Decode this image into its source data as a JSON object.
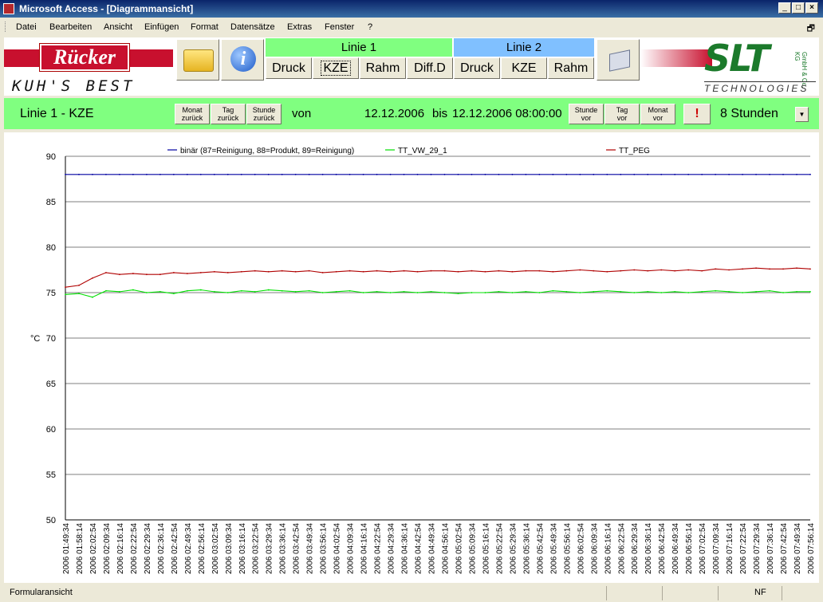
{
  "window": {
    "title": "Microsoft Access - [Diagrammansicht]"
  },
  "menu": [
    "Datei",
    "Bearbeiten",
    "Ansicht",
    "Einfügen",
    "Format",
    "Datensätze",
    "Extras",
    "Fenster",
    "?"
  ],
  "branding": {
    "left_logo": "Rücker",
    "left_tagline": "KUH'S BEST",
    "right_logo": "SLT",
    "right_logo_small": "GmbH & Co. KG",
    "right_tagline": "TECHNOLOGIES"
  },
  "colors": {
    "linie1": "#80ff80",
    "linie2": "#80c0ff",
    "series_binar": "#0000a0",
    "series_tt_vw": "#00e000",
    "series_tt_peg": "#b00000"
  },
  "toolbar": {
    "open_icon": "folder-icon",
    "info_icon": "info-icon",
    "print_icon": "printer-icon",
    "linie1": {
      "label": "Linie 1",
      "buttons": [
        "Druck",
        "KZE",
        "Rahm",
        "Diff.D"
      ],
      "active": "KZE"
    },
    "linie2": {
      "label": "Linie 2",
      "buttons": [
        "Druck",
        "KZE",
        "Rahm"
      ]
    }
  },
  "nav": {
    "view_title": "Linie 1 - KZE",
    "back_buttons": [
      {
        "l1": "Monat",
        "l2": "zurück"
      },
      {
        "l1": "Tag",
        "l2": "zurück"
      },
      {
        "l1": "Stunde",
        "l2": "zurück"
      }
    ],
    "von_label": "von",
    "from_date": "12.12.2006",
    "bis_label": "bis",
    "to_date": "12.12.2006 08:00:00",
    "fwd_buttons": [
      {
        "l1": "Stunde",
        "l2": "vor"
      },
      {
        "l1": "Tag",
        "l2": "vor"
      },
      {
        "l1": "Monat",
        "l2": "vor"
      }
    ],
    "warning_label": "!",
    "range_value": "8 Stunden",
    "dropdown_icon": "chevron-down-icon"
  },
  "chart_data": {
    "type": "line",
    "title": "",
    "xlabel": "",
    "ylabel": "°C",
    "ylim": [
      50,
      90
    ],
    "yticks": [
      50,
      55,
      60,
      65,
      70,
      75,
      80,
      85,
      90
    ],
    "grid": true,
    "legend_placement": "top",
    "x": [
      "2006 01:49:34",
      "2006 01:58:14",
      "2006 02:02:54",
      "2006 02:09:34",
      "2006 02:16:14",
      "2006 02:22:54",
      "2006 02:29:34",
      "2006 02:36:14",
      "2006 02:42:54",
      "2006 02:49:34",
      "2006 02:56:14",
      "2006 03:02:54",
      "2006 03:09:34",
      "2006 03:16:14",
      "2006 03:22:54",
      "2006 03:29:34",
      "2006 03:36:14",
      "2006 03:42:54",
      "2006 03:49:34",
      "2006 03:56:14",
      "2006 04:02:54",
      "2006 04:09:34",
      "2006 04:16:14",
      "2006 04:22:54",
      "2006 04:29:34",
      "2006 04:36:14",
      "2006 04:42:54",
      "2006 04:49:34",
      "2006 04:56:14",
      "2006 05:02:54",
      "2006 05:09:34",
      "2006 05:16:14",
      "2006 05:22:54",
      "2006 05:29:34",
      "2006 05:36:14",
      "2006 05:42:54",
      "2006 05:49:34",
      "2006 05:56:14",
      "2006 06:02:54",
      "2006 06:09:34",
      "2006 06:16:14",
      "2006 06:22:54",
      "2006 06:29:34",
      "2006 06:36:14",
      "2006 06:42:54",
      "2006 06:49:34",
      "2006 06:56:14",
      "2006 07:02:54",
      "2006 07:09:34",
      "2006 07:16:14",
      "2006 07:22:54",
      "2006 07:29:34",
      "2006 07:36:14",
      "2006 07:42:54",
      "2006 07:49:34",
      "2006 07:56:14"
    ],
    "series": [
      {
        "name": "binär (87=Reinigung, 88=Produkt, 89=Reinigung)",
        "color": "#0000a0",
        "values": [
          88,
          88,
          88,
          88,
          88,
          88,
          88,
          88,
          88,
          88,
          88,
          88,
          88,
          88,
          88,
          88,
          88,
          88,
          88,
          88,
          88,
          88,
          88,
          88,
          88,
          88,
          88,
          88,
          88,
          88,
          88,
          88,
          88,
          88,
          88,
          88,
          88,
          88,
          88,
          88,
          88,
          88,
          88,
          88,
          88,
          88,
          88,
          88,
          88,
          88,
          88,
          88,
          88,
          88,
          88,
          88
        ]
      },
      {
        "name": "TT_VW_29_1",
        "color": "#00e000",
        "values": [
          74.8,
          74.9,
          74.5,
          75.2,
          75.1,
          75.3,
          75.0,
          75.1,
          74.9,
          75.2,
          75.3,
          75.1,
          75.0,
          75.2,
          75.1,
          75.3,
          75.2,
          75.1,
          75.2,
          75.0,
          75.1,
          75.2,
          75.0,
          75.1,
          75.0,
          75.1,
          75.0,
          75.1,
          75.0,
          74.9,
          75.0,
          75.0,
          75.1,
          75.0,
          75.1,
          75.0,
          75.2,
          75.1,
          75.0,
          75.1,
          75.2,
          75.1,
          75.0,
          75.1,
          75.0,
          75.1,
          75.0,
          75.1,
          75.2,
          75.1,
          75.0,
          75.1,
          75.2,
          75.0,
          75.1,
          75.1
        ]
      },
      {
        "name": "TT_PEG",
        "color": "#b00000",
        "values": [
          75.6,
          75.8,
          76.6,
          77.2,
          77.0,
          77.1,
          77.0,
          77.0,
          77.2,
          77.1,
          77.2,
          77.3,
          77.2,
          77.3,
          77.4,
          77.3,
          77.4,
          77.3,
          77.4,
          77.2,
          77.3,
          77.4,
          77.3,
          77.4,
          77.3,
          77.4,
          77.3,
          77.4,
          77.4,
          77.3,
          77.4,
          77.3,
          77.4,
          77.3,
          77.4,
          77.4,
          77.3,
          77.4,
          77.5,
          77.4,
          77.3,
          77.4,
          77.5,
          77.4,
          77.5,
          77.4,
          77.5,
          77.4,
          77.6,
          77.5,
          77.6,
          77.7,
          77.6,
          77.6,
          77.7,
          77.6
        ]
      }
    ]
  },
  "status": {
    "text": "Formularansicht",
    "mode": "NF"
  }
}
